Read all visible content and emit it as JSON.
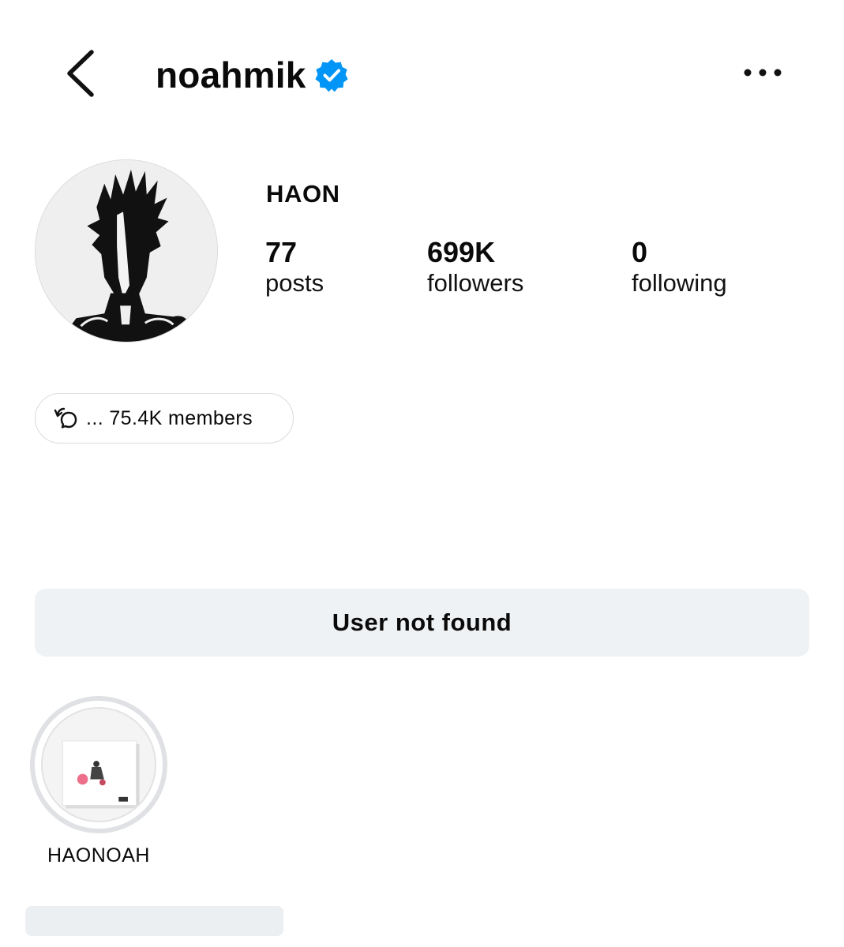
{
  "header": {
    "username": "noahmik",
    "verified": true,
    "back_icon": "chevron-left-icon",
    "more_icon": "more-horizontal-icon",
    "verified_color": "#0095f6"
  },
  "profile": {
    "display_name": "HAON",
    "avatar_icon": "avatar-image",
    "stats": {
      "posts": {
        "value": "77",
        "label": "posts"
      },
      "followers": {
        "value": "699K",
        "label": "followers"
      },
      "following": {
        "value": "0",
        "label": "following"
      }
    }
  },
  "channel": {
    "icon": "broadcast-channel-icon",
    "text": "... 75.4K members"
  },
  "actions": {
    "user_not_found_label": "User not found"
  },
  "highlights": [
    {
      "label": "HAONOAH",
      "icon": "album-cover-thumbnail"
    }
  ]
}
